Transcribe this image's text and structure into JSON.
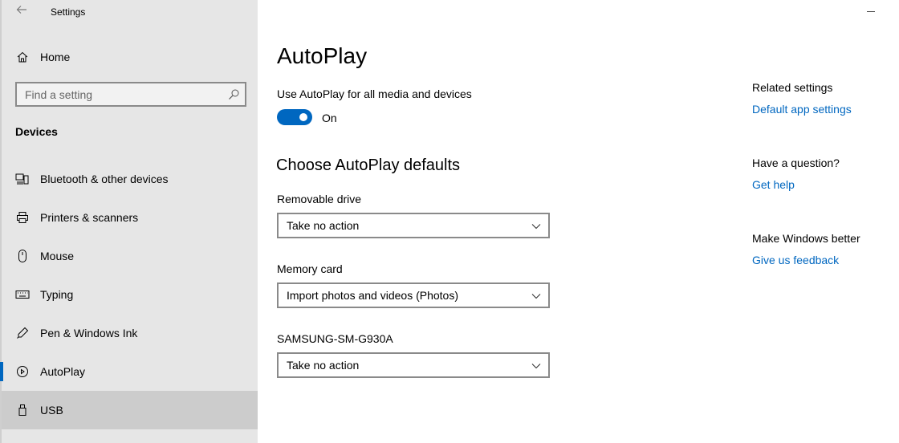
{
  "window": {
    "title": "Settings"
  },
  "sidebar": {
    "home_label": "Home",
    "search_placeholder": "Find a setting",
    "section_title": "Devices",
    "items": [
      {
        "label": "Bluetooth & other devices",
        "icon": "bluetooth-devices-icon"
      },
      {
        "label": "Printers & scanners",
        "icon": "printer-icon"
      },
      {
        "label": "Mouse",
        "icon": "mouse-icon"
      },
      {
        "label": "Typing",
        "icon": "keyboard-icon"
      },
      {
        "label": "Pen & Windows Ink",
        "icon": "pen-icon"
      },
      {
        "label": "AutoPlay",
        "icon": "autoplay-icon",
        "selected": true
      },
      {
        "label": "USB",
        "icon": "usb-icon",
        "hovered": true
      }
    ]
  },
  "main": {
    "title": "AutoPlay",
    "toggle_label": "Use AutoPlay for all media and devices",
    "toggle_state": "On",
    "defaults_title": "Choose AutoPlay defaults",
    "fields": [
      {
        "label": "Removable drive",
        "value": "Take no action"
      },
      {
        "label": "Memory card",
        "value": "Import photos and videos (Photos)"
      },
      {
        "label": "SAMSUNG-SM-G930A",
        "value": "Take no action"
      }
    ]
  },
  "related": {
    "related_heading": "Related settings",
    "default_app_link": "Default app settings",
    "question_heading": "Have a question?",
    "help_link": "Get help",
    "better_heading": "Make Windows better",
    "feedback_link": "Give us feedback"
  },
  "colors": {
    "accent": "#0067c0",
    "sidebar_bg": "#e6e6e6",
    "hover_bg": "#cccccc"
  }
}
